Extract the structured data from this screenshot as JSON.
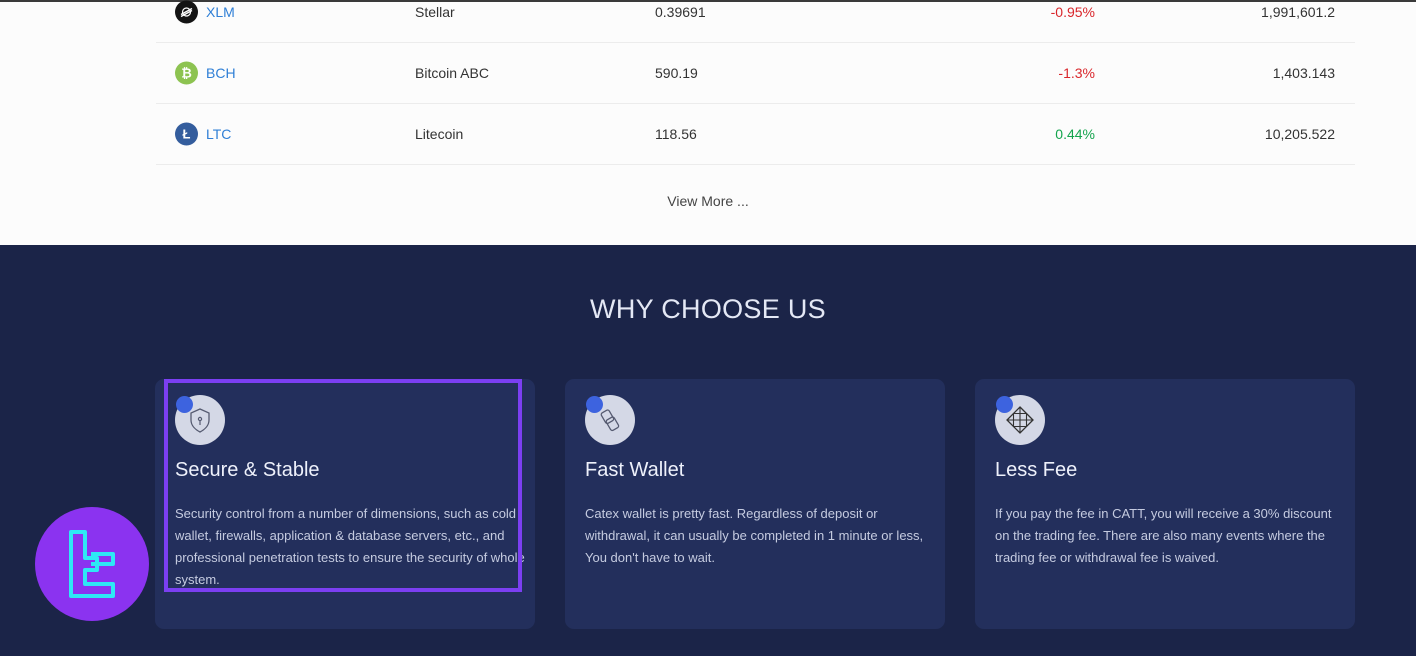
{
  "market": {
    "rows": [
      {
        "symbol": "XLM",
        "name": "Stellar",
        "price": "0.39691",
        "change": "-0.95%",
        "volume": "1,991,601.2",
        "icon": "stellar-icon"
      },
      {
        "symbol": "BCH",
        "name": "Bitcoin ABC",
        "price": "590.19",
        "change": "-1.3%",
        "volume": "1,403.143",
        "icon": "bitcoin-cash-icon"
      },
      {
        "symbol": "LTC",
        "name": "Litecoin",
        "price": "118.56",
        "change": "0.44%",
        "volume": "10,205.522",
        "icon": "litecoin-icon"
      }
    ],
    "view_more": "View More ..."
  },
  "why": {
    "title": "WHY CHOOSE US",
    "features": [
      {
        "title": "Secure & Stable",
        "text": "Security control from a number of dimensions, such as cold wallet, firewalls, application & database servers, etc., and professional penetration tests to ensure the security of whole system.",
        "icon": "shield-icon"
      },
      {
        "title": "Fast Wallet",
        "text": "Catex wallet is pretty fast. Regardless of deposit or withdrawal, it can usually be completed in 1 minute or less, You don't have to wait.",
        "icon": "wallet-icon"
      },
      {
        "title": "Less Fee",
        "text": "If you pay the fee in CATT, you will receive a 30% discount on the trading fee. There are also many events where the trading fee or withdrawal fee is waived.",
        "icon": "grid-icon"
      }
    ]
  },
  "colors": {
    "accent": "#2f7fd6",
    "negative": "#d9262b",
    "positive": "#14a44d",
    "highlight": "#7b3ff2",
    "dark_bg": "#1b2448",
    "card_bg": "#232f5c",
    "logo_bg": "#8b33f0",
    "logo_stroke": "#2ee8f5"
  }
}
